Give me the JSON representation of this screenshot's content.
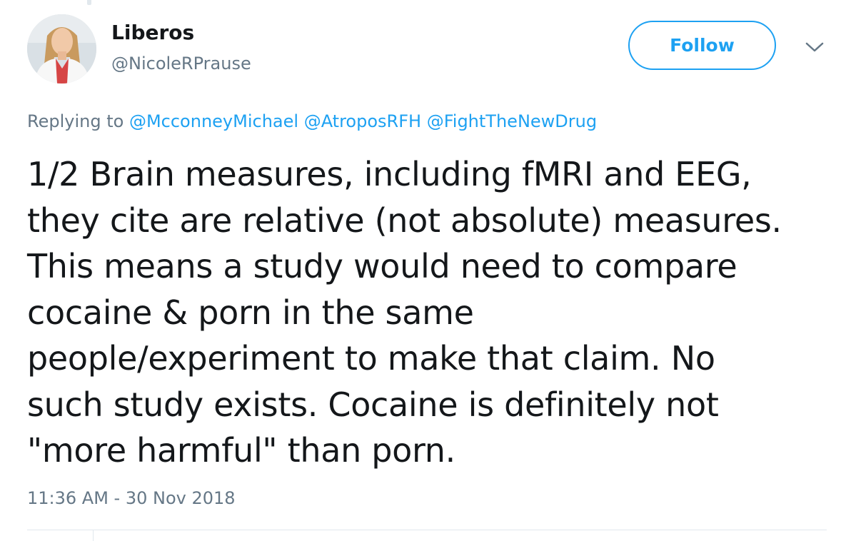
{
  "tweet": {
    "author": {
      "display_name": "Liberos",
      "handle": "@NicoleRPrause",
      "avatar_icon": "profile-photo"
    },
    "follow_label": "Follow",
    "menu_icon": "chevron-down-icon",
    "replying": {
      "prefix": "Replying to",
      "mentions": [
        "@McconneyMichael",
        "@AtroposRFH",
        "@FightTheNewDrug"
      ]
    },
    "text_lines": [
      "1/2 Brain measures, including fMRI and EEG,",
      "they cite are relative (not absolute) measures.",
      "This means a study would need to compare",
      "cocaine & porn in the same",
      "people/experiment to make that claim. No",
      "such study exists. Cocaine is definitely not",
      "\"more harmful\" than porn."
    ],
    "timestamp": "11:36 AM - 30 Nov 2018"
  },
  "colors": {
    "accent": "#1da1f2",
    "secondary_text": "#657786",
    "primary_text": "#14171a",
    "divider": "#e1e8ed"
  }
}
